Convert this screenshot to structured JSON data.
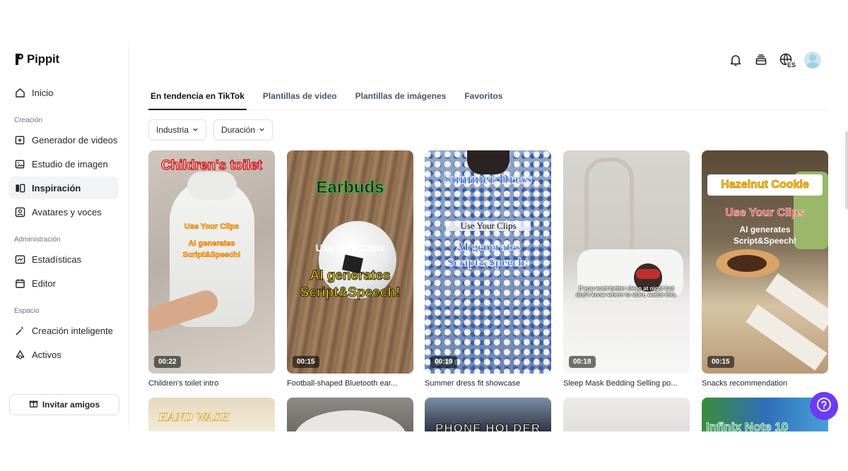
{
  "brand": {
    "name": "Pippit"
  },
  "sidebar": {
    "home": "Inicio",
    "sections": [
      {
        "label": "Creación",
        "items": [
          "Generador de videos",
          "Estudio de imagen",
          "Inspiración",
          "Avatares y voces"
        ]
      },
      {
        "label": "Administración",
        "items": [
          "Estadísticas",
          "Editor"
        ]
      },
      {
        "label": "Espacio",
        "items": [
          "Creación inteligente",
          "Activos"
        ]
      }
    ],
    "active_item": "Inspiración",
    "invite_label": "Invitar amigos"
  },
  "header": {
    "language_badge": "ES"
  },
  "tabs": [
    "En tendencia en TikTok",
    "Plantillas de video",
    "Plantillas de imágenes",
    "Favoritos"
  ],
  "active_tab": "En tendencia en TikTok",
  "filters": [
    "Industria",
    "Duración"
  ],
  "cards": [
    {
      "caption": "Children's toilet intro",
      "duration": "00:22",
      "overlay": {
        "title": "Children's toilet",
        "line1": "Use Your Clips",
        "line2": "AI generates",
        "line3": "Script&Speech!"
      }
    },
    {
      "caption": "Football-shaped Bluetooth ear...",
      "duration": "00:15",
      "overlay": {
        "title": "Earbuds",
        "line1": "Use Your Clips",
        "line2": "AI generates",
        "line3": "Script&Speech!"
      }
    },
    {
      "caption": "Summer dress fit showcase",
      "duration": "00:19",
      "overlay": {
        "title": "Summer Dress",
        "line1": "Use Your Clips",
        "line2": "AI generates",
        "line3": "Script&Speech!"
      }
    },
    {
      "caption": "Sleep Mask Bedding Selling po...",
      "duration": "00:18",
      "overlay": {
        "subtitle": "If you want better sleep at night but don't know where to start, watch this."
      }
    },
    {
      "caption": "Snacks recommendation",
      "duration": "00:15",
      "overlay": {
        "title": "Hazelnut Cookie",
        "line1": "Use Your Clips",
        "line2": "AI generates",
        "line3": "Script&Speech!"
      }
    }
  ],
  "row2_overlays": [
    "HAND WASH",
    "",
    "PHONE HOLDER",
    "",
    "Infinix Note 10"
  ],
  "colors": {
    "accent": "#6c3bf5",
    "overlay_red": "#e8382a",
    "overlay_yellow": "#ffd400",
    "overlay_green": "#2fbf3a"
  }
}
